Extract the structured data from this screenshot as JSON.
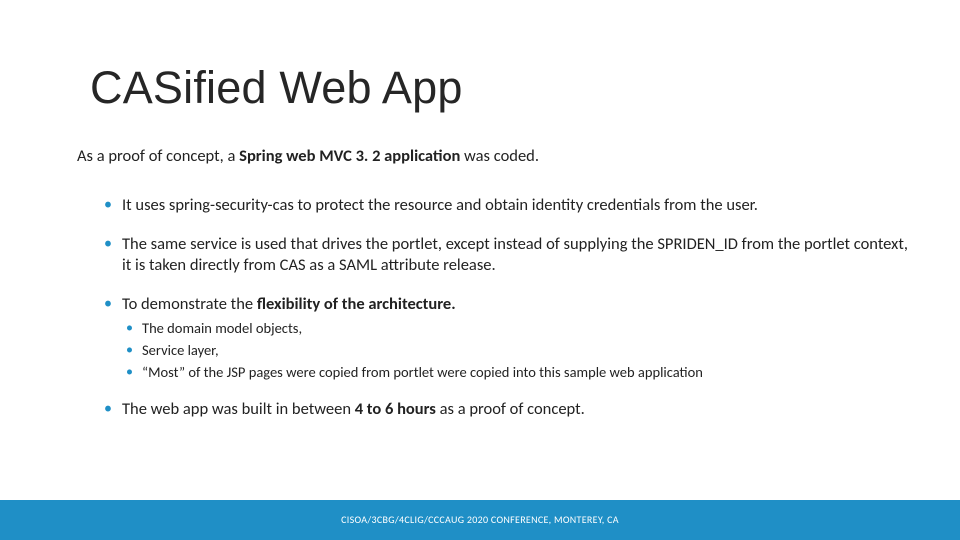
{
  "slide": {
    "title": "CASified Web App",
    "intro_pre": "As a proof of concept, a ",
    "intro_bold": "Spring web MVC 3. 2 application ",
    "intro_post": "was coded.",
    "bullets": {
      "b1": "It uses spring-security-cas to protect the resource and obtain identity credentials from the user.",
      "b2": "The same service is used that drives the portlet, except instead of supplying the SPRIDEN_ID from the portlet context, it is taken directly from CAS as a SAML attribute release.",
      "b3_pre": "To demonstrate the ",
      "b3_bold": "flexibility of the architecture.",
      "b3_sub1": "The domain model objects,",
      "b3_sub2": "Service layer,",
      "b3_sub3": "“Most” of the JSP pages were copied from portlet were copied into this sample web application",
      "b4_pre": "The web app was built in between ",
      "b4_bold": "4 to 6 hours ",
      "b4_post": "as a proof of concept."
    },
    "footer": "CISOA/3CBG/4CLIG/CCCAUG 2020 CONFERENCE, MONTEREY, CA"
  }
}
